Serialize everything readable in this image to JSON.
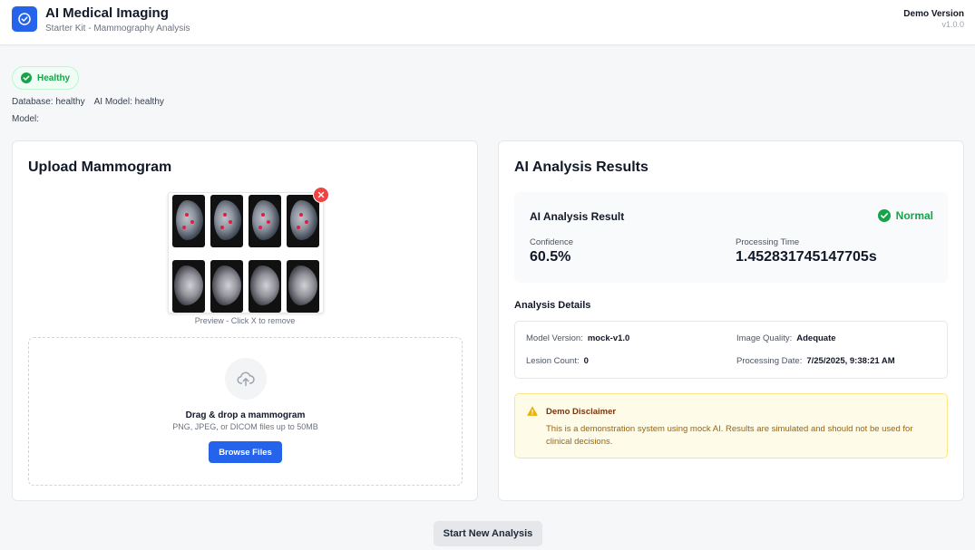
{
  "header": {
    "title": "AI Medical Imaging",
    "subtitle": "Starter Kit - Mammography Analysis",
    "version_label": "Demo Version",
    "version_number": "v1.0.0"
  },
  "status": {
    "badge_label": "Healthy",
    "database": "Database: healthy",
    "ai_model": "AI Model: healthy",
    "model": "Model:"
  },
  "upload": {
    "title": "Upload Mammogram",
    "preview_caption": "Preview - Click X to remove",
    "dropzone_title": "Drag & drop a mammogram",
    "dropzone_subtitle": "PNG, JPEG, or DICOM files up to 50MB",
    "browse_label": "Browse Files"
  },
  "results": {
    "title": "AI Analysis Results",
    "result_heading": "AI Analysis Result",
    "result_status": "Normal",
    "confidence_label": "Confidence",
    "confidence_value": "60.5%",
    "processing_time_label": "Processing Time",
    "processing_time_value": "1.452831745147705s",
    "details_title": "Analysis Details",
    "details": {
      "model_version_label": "Model Version:",
      "model_version_value": "mock-v1.0",
      "image_quality_label": "Image Quality:",
      "image_quality_value": "Adequate",
      "lesion_count_label": "Lesion Count:",
      "lesion_count_value": "0",
      "processing_date_label": "Processing Date:",
      "processing_date_value": "7/25/2025, 9:38:21 AM"
    },
    "disclaimer_title": "Demo Disclaimer",
    "disclaimer_text": "This is a demonstration system using mock AI. Results are simulated and should not be used for clinical decisions."
  },
  "actions": {
    "start_new_label": "Start New Analysis"
  },
  "colors": {
    "primary": "#2563eb",
    "success": "#16a34a",
    "danger": "#ef4444",
    "warning": "#eab308"
  }
}
